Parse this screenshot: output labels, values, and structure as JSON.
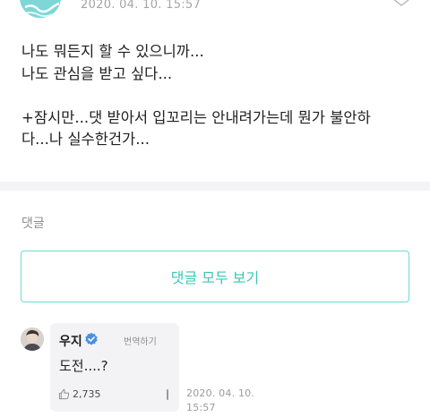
{
  "post": {
    "date": "2020. 04. 10. 15:57",
    "lines": [
      "나도 뭐든지 할 수 있으니까...",
      "나도 관심을 받고 싶다...",
      "",
      "+잠시만...댓 받아서 입꼬리는 안내려가는데 뭔가 불안하",
      "다...나 실수한건가..."
    ]
  },
  "comments_section": {
    "heading": "댓글",
    "view_all_label": "댓글 모두 보기"
  },
  "comment": {
    "author": "우지",
    "translate_label": "번역하기",
    "text": "도전....?",
    "likes": "2,735",
    "date_line1": "2020. 04. 10.",
    "date_line2": "15:57"
  },
  "colors": {
    "accent": "#3cc5b5",
    "accent_border": "#6fd9cf",
    "verified": "#4a90e2"
  },
  "icons": {
    "verified": "verified-badge-icon",
    "like": "thumbs-up-icon",
    "menu": "more-vertical-icon"
  }
}
